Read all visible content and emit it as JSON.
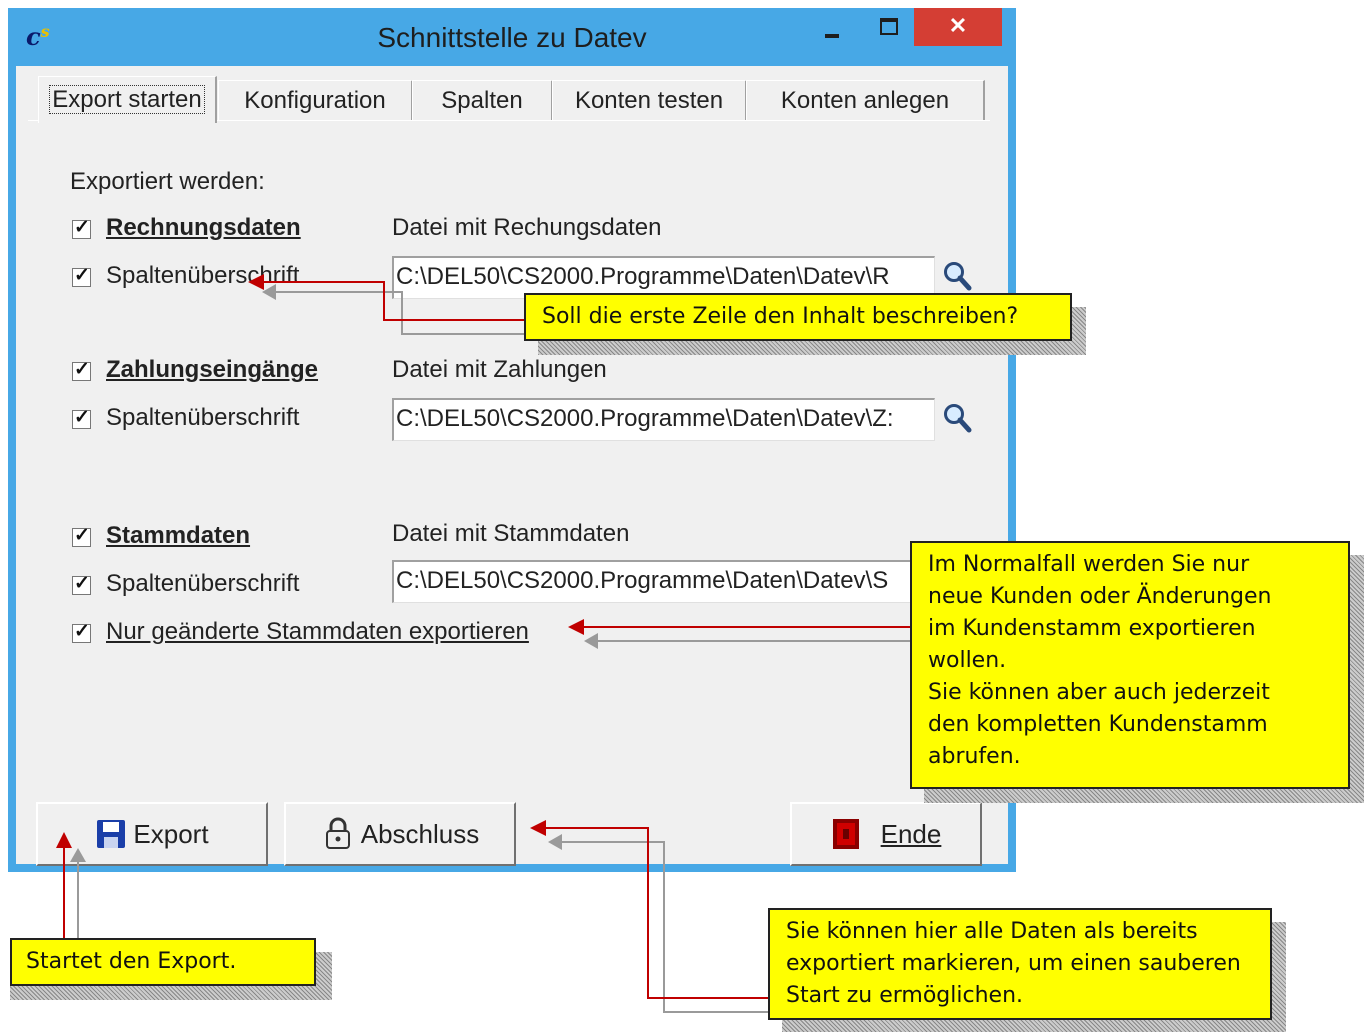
{
  "window": {
    "title": "Schnittstelle zu Datev",
    "close_label": "✕"
  },
  "tabs": [
    {
      "label": "Export starten",
      "active": true
    },
    {
      "label": "Konfiguration"
    },
    {
      "label": "Spalten"
    },
    {
      "label": "Konten testen"
    },
    {
      "label": "Konten anlegen"
    }
  ],
  "export": {
    "section_label": "Exportiert werden:",
    "rechnung": {
      "checkbox_label": "Rechnungsdaten",
      "header_checkbox_label": "Spaltenüberschrift",
      "file_label": "Datei mit Rechungsdaten",
      "file_value": "C:\\DEL50\\CS2000.Programme\\Daten\\Datev\\R"
    },
    "zahlung": {
      "checkbox_label": "Zahlungseingänge",
      "header_checkbox_label": "Spaltenüberschrift",
      "file_label": "Datei mit Zahlungen",
      "file_value": "C:\\DEL50\\CS2000.Programme\\Daten\\Datev\\Z:"
    },
    "stamm": {
      "checkbox_label": "Stammdaten",
      "header_checkbox_label": "Spaltenüberschrift",
      "file_label": "Datei mit Stammdaten",
      "file_value": "C:\\DEL50\\CS2000.Programme\\Daten\\Datev\\S",
      "only_changed_label": "Nur geänderte Stammdaten exportieren"
    }
  },
  "buttons": {
    "export": "Export",
    "abschluss": "Abschluss",
    "ende": "Ende"
  },
  "callouts": {
    "header": "Soll die erste Zeile den Inhalt beschreiben?",
    "stamm": [
      "Im Normalfall werden Sie nur",
      "neue Kunden oder Änderungen",
      "im Kundenstamm exportieren",
      "wollen.",
      "Sie können aber auch jederzeit",
      "den kompletten Kundenstamm",
      "abrufen."
    ],
    "export": "Startet den Export.",
    "abschluss": [
      "Sie können hier alle Daten als bereits",
      "exportiert markieren, um einen sauberen",
      "Start zu ermöglichen."
    ]
  },
  "colors": {
    "callout_bg": "#ffff00",
    "arrow": "#c00000",
    "window_frame": "#47a8e6",
    "close_button": "#d43e34"
  }
}
